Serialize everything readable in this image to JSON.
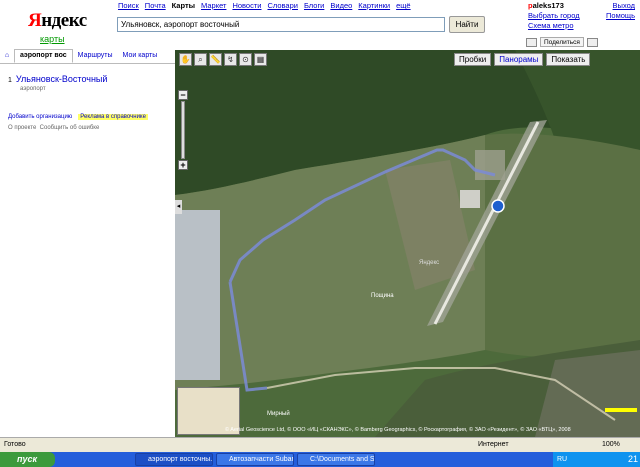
{
  "logo": {
    "first": "Я",
    "rest": "ндекс",
    "sub": "карты"
  },
  "topnav": [
    "Поиск",
    "Почта",
    "Карты",
    "Маркет",
    "Новости",
    "Словари",
    "Блоги",
    "Видео",
    "Картинки",
    "ещё"
  ],
  "topnav_current": "Карты",
  "search": {
    "value": "Ульяновск, аэропорт восточный",
    "button": "Найти"
  },
  "user": {
    "name_first": "p",
    "name_rest": "aleks173",
    "link1": "Выбрать город",
    "link2": "Схема метро",
    "exit": "Выход",
    "help": "Помощь"
  },
  "share": "Поделиться",
  "tabs": {
    "search": "аэропорт вос",
    "routes": "Маршруты",
    "my_maps": "Мои карты"
  },
  "result": {
    "num": "1",
    "title": "Ульяновск-Восточный",
    "sub": "аэропорт"
  },
  "links": {
    "add_org": "Добавить организацию",
    "ad": "Реклама в справочнике",
    "about": "О проекте",
    "report": "Сообщить об ошибке"
  },
  "map": {
    "buttons": {
      "traffic": "Пробки",
      "panoramas": "Панорамы",
      "show": "Показать"
    },
    "labels": {
      "yandex": "Яндекс",
      "poshchina": "Пощина",
      "mirny": "Мирный",
      "road": "Р-241"
    },
    "copyright": "© Aerial Geoscience Ltd, © ООО «ИЦ «СКАНЭКС», © Bamberg Geographics, © Роскартография, © ЗАО «Резидент», © ЗАО «ВТЦ», 2008"
  },
  "statusbar": {
    "ready": "Готово",
    "zone": "Интернет",
    "zoom": "100%"
  },
  "taskbar": {
    "start": "пуск",
    "tasks": [
      "аэропорт восточны...",
      "Автозапчасти Subar...",
      "C:\\Documents and Se..."
    ],
    "lang": "RU",
    "clock": "21"
  },
  "colors": {
    "route": "#7b8bd6",
    "brand_red": "#ff0000",
    "link": "#0000cc"
  }
}
